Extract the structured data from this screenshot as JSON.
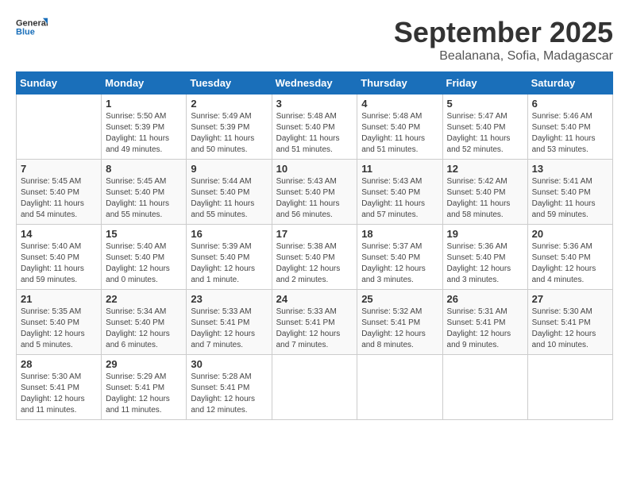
{
  "logo": {
    "general": "General",
    "blue": "Blue"
  },
  "title": "September 2025",
  "subtitle": "Bealanana, Sofia, Madagascar",
  "days_of_week": [
    "Sunday",
    "Monday",
    "Tuesday",
    "Wednesday",
    "Thursday",
    "Friday",
    "Saturday"
  ],
  "weeks": [
    [
      {
        "day": "",
        "info": ""
      },
      {
        "day": "1",
        "info": "Sunrise: 5:50 AM\nSunset: 5:39 PM\nDaylight: 11 hours\nand 49 minutes."
      },
      {
        "day": "2",
        "info": "Sunrise: 5:49 AM\nSunset: 5:39 PM\nDaylight: 11 hours\nand 50 minutes."
      },
      {
        "day": "3",
        "info": "Sunrise: 5:48 AM\nSunset: 5:40 PM\nDaylight: 11 hours\nand 51 minutes."
      },
      {
        "day": "4",
        "info": "Sunrise: 5:48 AM\nSunset: 5:40 PM\nDaylight: 11 hours\nand 51 minutes."
      },
      {
        "day": "5",
        "info": "Sunrise: 5:47 AM\nSunset: 5:40 PM\nDaylight: 11 hours\nand 52 minutes."
      },
      {
        "day": "6",
        "info": "Sunrise: 5:46 AM\nSunset: 5:40 PM\nDaylight: 11 hours\nand 53 minutes."
      }
    ],
    [
      {
        "day": "7",
        "info": "Sunrise: 5:45 AM\nSunset: 5:40 PM\nDaylight: 11 hours\nand 54 minutes."
      },
      {
        "day": "8",
        "info": "Sunrise: 5:45 AM\nSunset: 5:40 PM\nDaylight: 11 hours\nand 55 minutes."
      },
      {
        "day": "9",
        "info": "Sunrise: 5:44 AM\nSunset: 5:40 PM\nDaylight: 11 hours\nand 55 minutes."
      },
      {
        "day": "10",
        "info": "Sunrise: 5:43 AM\nSunset: 5:40 PM\nDaylight: 11 hours\nand 56 minutes."
      },
      {
        "day": "11",
        "info": "Sunrise: 5:43 AM\nSunset: 5:40 PM\nDaylight: 11 hours\nand 57 minutes."
      },
      {
        "day": "12",
        "info": "Sunrise: 5:42 AM\nSunset: 5:40 PM\nDaylight: 11 hours\nand 58 minutes."
      },
      {
        "day": "13",
        "info": "Sunrise: 5:41 AM\nSunset: 5:40 PM\nDaylight: 11 hours\nand 59 minutes."
      }
    ],
    [
      {
        "day": "14",
        "info": "Sunrise: 5:40 AM\nSunset: 5:40 PM\nDaylight: 11 hours\nand 59 minutes."
      },
      {
        "day": "15",
        "info": "Sunrise: 5:40 AM\nSunset: 5:40 PM\nDaylight: 12 hours\nand 0 minutes."
      },
      {
        "day": "16",
        "info": "Sunrise: 5:39 AM\nSunset: 5:40 PM\nDaylight: 12 hours\nand 1 minute."
      },
      {
        "day": "17",
        "info": "Sunrise: 5:38 AM\nSunset: 5:40 PM\nDaylight: 12 hours\nand 2 minutes."
      },
      {
        "day": "18",
        "info": "Sunrise: 5:37 AM\nSunset: 5:40 PM\nDaylight: 12 hours\nand 3 minutes."
      },
      {
        "day": "19",
        "info": "Sunrise: 5:36 AM\nSunset: 5:40 PM\nDaylight: 12 hours\nand 3 minutes."
      },
      {
        "day": "20",
        "info": "Sunrise: 5:36 AM\nSunset: 5:40 PM\nDaylight: 12 hours\nand 4 minutes."
      }
    ],
    [
      {
        "day": "21",
        "info": "Sunrise: 5:35 AM\nSunset: 5:40 PM\nDaylight: 12 hours\nand 5 minutes."
      },
      {
        "day": "22",
        "info": "Sunrise: 5:34 AM\nSunset: 5:40 PM\nDaylight: 12 hours\nand 6 minutes."
      },
      {
        "day": "23",
        "info": "Sunrise: 5:33 AM\nSunset: 5:41 PM\nDaylight: 12 hours\nand 7 minutes."
      },
      {
        "day": "24",
        "info": "Sunrise: 5:33 AM\nSunset: 5:41 PM\nDaylight: 12 hours\nand 7 minutes."
      },
      {
        "day": "25",
        "info": "Sunrise: 5:32 AM\nSunset: 5:41 PM\nDaylight: 12 hours\nand 8 minutes."
      },
      {
        "day": "26",
        "info": "Sunrise: 5:31 AM\nSunset: 5:41 PM\nDaylight: 12 hours\nand 9 minutes."
      },
      {
        "day": "27",
        "info": "Sunrise: 5:30 AM\nSunset: 5:41 PM\nDaylight: 12 hours\nand 10 minutes."
      }
    ],
    [
      {
        "day": "28",
        "info": "Sunrise: 5:30 AM\nSunset: 5:41 PM\nDaylight: 12 hours\nand 11 minutes."
      },
      {
        "day": "29",
        "info": "Sunrise: 5:29 AM\nSunset: 5:41 PM\nDaylight: 12 hours\nand 11 minutes."
      },
      {
        "day": "30",
        "info": "Sunrise: 5:28 AM\nSunset: 5:41 PM\nDaylight: 12 hours\nand 12 minutes."
      },
      {
        "day": "",
        "info": ""
      },
      {
        "day": "",
        "info": ""
      },
      {
        "day": "",
        "info": ""
      },
      {
        "day": "",
        "info": ""
      }
    ]
  ]
}
